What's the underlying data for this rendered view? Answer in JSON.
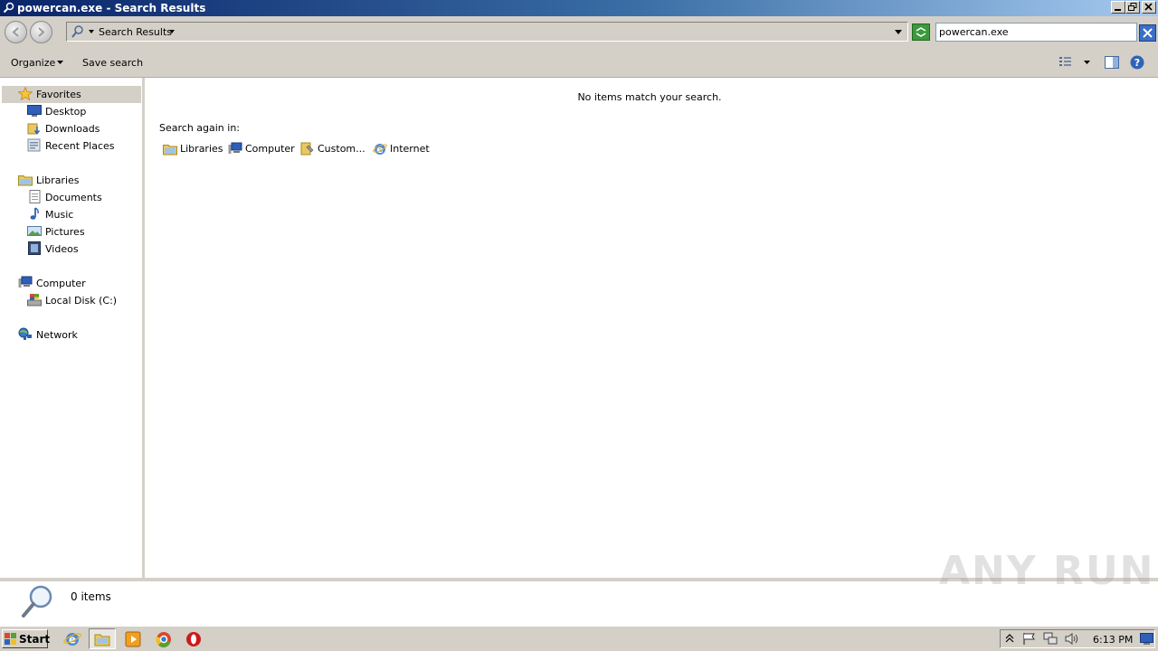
{
  "window": {
    "title": "powercan.exe - Search Results"
  },
  "address_bar": {
    "breadcrumb": "Search Results"
  },
  "search": {
    "value": "powercan.exe"
  },
  "toolbar": {
    "organize_label": "Organize",
    "save_search_label": "Save search"
  },
  "nav_pane": {
    "favorites": {
      "label": "Favorites",
      "items": [
        "Desktop",
        "Downloads",
        "Recent Places"
      ]
    },
    "libraries": {
      "label": "Libraries",
      "items": [
        "Documents",
        "Music",
        "Pictures",
        "Videos"
      ]
    },
    "computer": {
      "label": "Computer",
      "items": [
        "Local Disk (C:)"
      ]
    },
    "network": {
      "label": "Network"
    }
  },
  "content": {
    "empty_message": "No items match your search.",
    "search_again_label": "Search again in:",
    "locations": [
      "Libraries",
      "Computer",
      "Custom...",
      "Internet"
    ]
  },
  "details": {
    "item_count": "0 items"
  },
  "taskbar": {
    "start_label": "Start",
    "clock": "6:13 PM"
  },
  "watermark": "ANY RUN"
}
